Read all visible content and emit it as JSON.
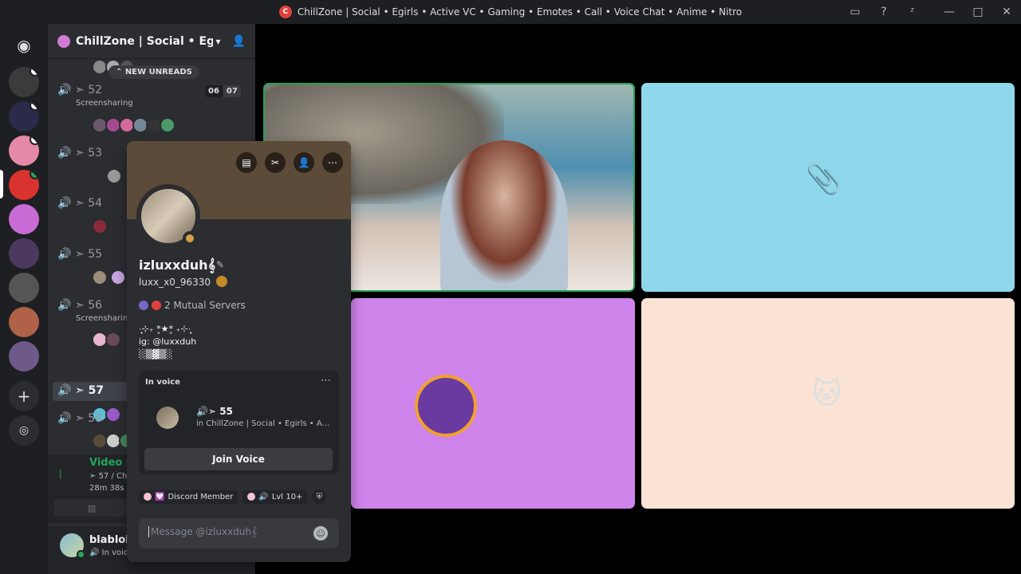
{
  "window": {
    "title": "ChillZone | Social • Egirls • Active VC • Gaming • Emotes • Call • Voice Chat • Anime • Nitro"
  },
  "guild": {
    "name": "ChillZone | Social • Egir...",
    "new_unreads": "NEW UNREADS"
  },
  "voice_channels": [
    {
      "name": "52",
      "sub": "Screensharing",
      "count_a": "06",
      "count_b": "07"
    },
    {
      "name": "53"
    },
    {
      "name": "54"
    },
    {
      "name": "55"
    },
    {
      "name": "56",
      "sub": "Screensharin"
    },
    {
      "name": "57"
    },
    {
      "name": "58"
    }
  ],
  "voice_panel": {
    "title": "Video Connected",
    "sub": "57 / ChillZone | Soc",
    "time": "28m  38s"
  },
  "user_panel": {
    "name": "blablobleebloobl",
    "status": "In voice •"
  },
  "profile": {
    "display_name": "izluxxduh𝄞",
    "username": "luxx_x0_96330",
    "mutual_servers": "2 Mutual Servers",
    "bio": "·͙̥⊹₊ *̥★*̥ ₊⊹·͙̥\nig: @luxxduh\n░▒▓▒░",
    "in_voice_label": "In voice",
    "voice_channel": "55",
    "voice_guild": "in ChillZone | Social • Egirls • Active VC",
    "join_voice": "Join Voice",
    "roles": [
      "Discord Member",
      "Lvl 10+"
    ],
    "message_placeholder": "Message @izluxxduh𝄞"
  },
  "colors": {
    "speaking": "#23a55a",
    "tile_blue": "#8fd7ea",
    "tile_purple": "#cf84ec",
    "tile_peach": "#fae3d4"
  }
}
